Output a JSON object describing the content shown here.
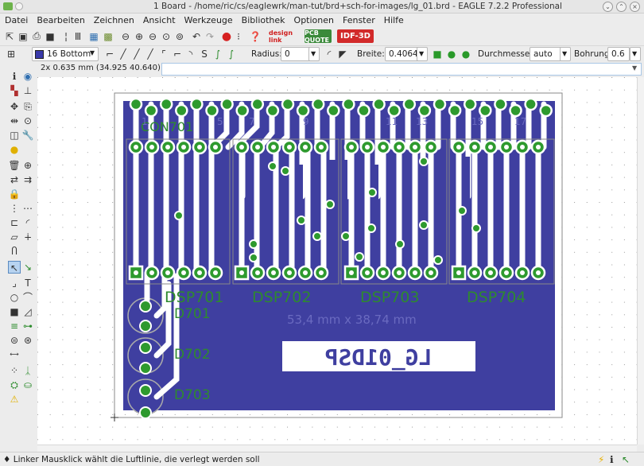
{
  "window": {
    "title": "1 Board - /home/ric/cs/eaglewrk/man-tut/brd+sch-for-images/lg_01.brd - EAGLE 7.2.2 Professional"
  },
  "menu": [
    "Datei",
    "Bearbeiten",
    "Zeichnen",
    "Ansicht",
    "Werkzeuge",
    "Bibliothek",
    "Optionen",
    "Fenster",
    "Hilfe"
  ],
  "toolbar": {
    "designlink_label": "design link",
    "pcbquote_label": "PCB QUOTE",
    "idf_label": "IDF-3D"
  },
  "params": {
    "layer": "16 Bottom",
    "radius_label": "Radius:",
    "radius_value": "0",
    "width_label": "Breite:",
    "width_value": "0.4064",
    "diameter_label": "Durchmesser:",
    "diameter_value": "auto",
    "drill_label": "Bohrung:",
    "drill_value": "0.6",
    "layer_color": "#3a3aaa"
  },
  "coord_display": "2x 0.635 mm (34.925 40.640)",
  "command_input": "",
  "board": {
    "connector_label": "CON701",
    "pin_numbers": [
      "1",
      "5",
      "7",
      "9",
      "11",
      "13",
      "15",
      "17",
      "19"
    ],
    "displays": [
      "DSP701",
      "DSP702",
      "DSP703",
      "DSP704"
    ],
    "leds": [
      "D701",
      "D702",
      "D703"
    ],
    "dimensions": "53,4 mm x 38,74 mm",
    "name_plate": "LG_01DSP",
    "copper_color": "#3f3fa0",
    "pad_color": "#2e9a2e",
    "trace_color": "#ffffff"
  },
  "status": {
    "message": "Linker Mausklick wählt die Luftlinie, die verlegt werden soll"
  }
}
